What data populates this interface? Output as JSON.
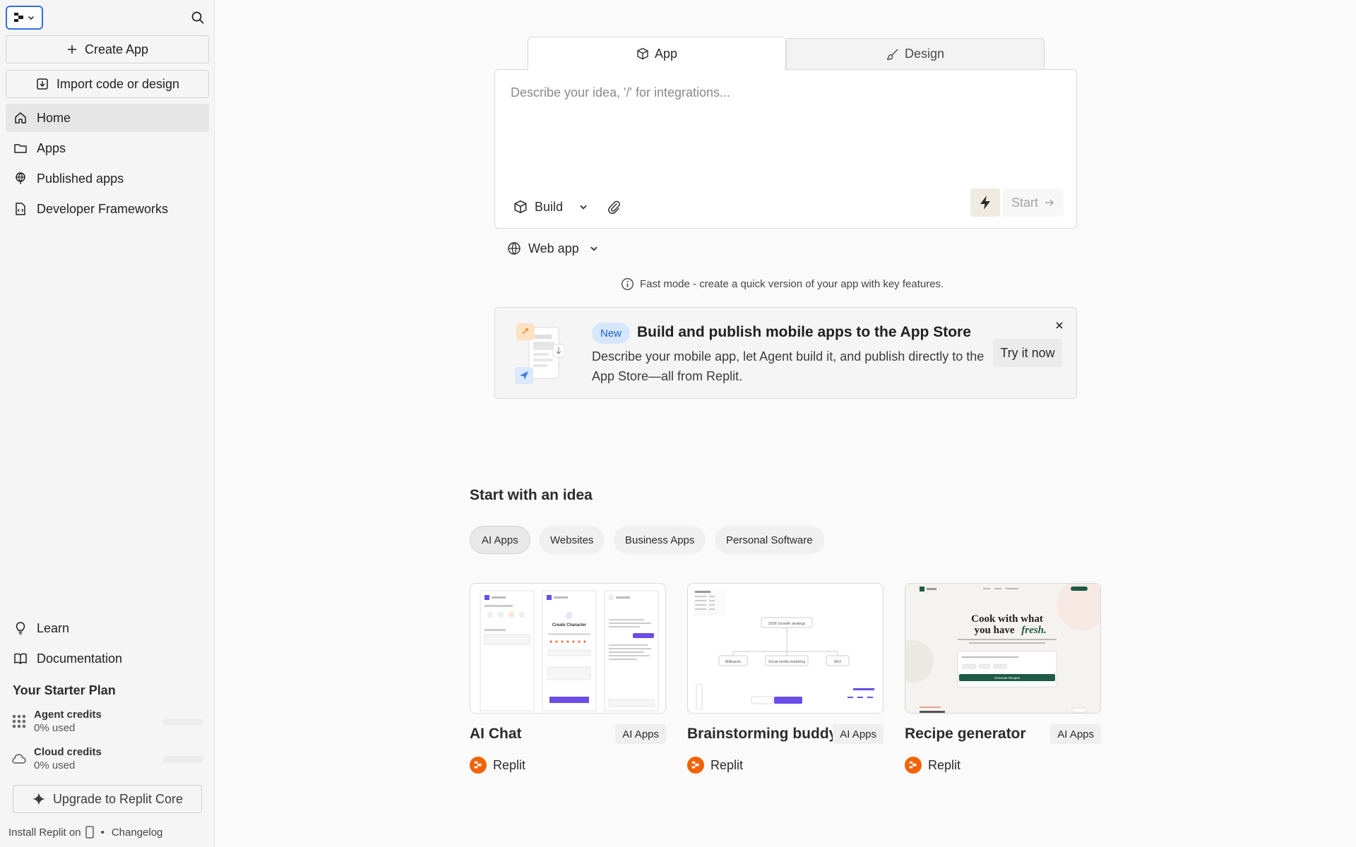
{
  "sidebar": {
    "create_app": "Create App",
    "import_code": "Import code or design",
    "nav": [
      {
        "label": "Home",
        "icon": "home-icon"
      },
      {
        "label": "Apps",
        "icon": "folder-icon"
      },
      {
        "label": "Published apps",
        "icon": "globe-icon"
      },
      {
        "label": "Developer Frameworks",
        "icon": "file-code-icon"
      }
    ],
    "learn": "Learn",
    "documentation": "Documentation",
    "plan_title": "Your Starter Plan",
    "agent_credits": {
      "name": "Agent credits",
      "used": "0% used",
      "progress": 0
    },
    "cloud_credits": {
      "name": "Cloud credits",
      "used": "0% used",
      "progress": 0
    },
    "upgrade": "Upgrade to Replit Core",
    "install": "Install Replit on",
    "separator": "•",
    "changelog": "Changelog"
  },
  "prompt": {
    "tabs": [
      {
        "label": "App",
        "icon": "cube-icon",
        "active": true
      },
      {
        "label": "Design",
        "icon": "brush-icon",
        "active": false
      }
    ],
    "placeholder": "Describe your idea, '/' for integrations...",
    "build_label": "Build",
    "start_label": "Start",
    "web_app_label": "Web app",
    "fast_mode_note": "Fast mode - create a quick version of your app with key features."
  },
  "promo": {
    "badge": "New",
    "title": "Build and publish mobile apps to the App Store",
    "description": "Describe your mobile app, let Agent build it, and publish directly to the App Store—all from Replit.",
    "cta": "Try it now"
  },
  "ideas": {
    "title": "Start with an idea",
    "chips": [
      "AI Apps",
      "Websites",
      "Business Apps",
      "Personal Software"
    ],
    "active_chip": "AI Apps",
    "cards": [
      {
        "title": "AI Chat",
        "tag": "AI Apps",
        "author": "Replit"
      },
      {
        "title": "Brainstorming buddy",
        "tag": "AI Apps",
        "author": "Replit"
      },
      {
        "title": "Recipe generator",
        "tag": "AI Apps",
        "author": "Replit"
      }
    ],
    "thumb_text": {
      "chat_create": "Create Character",
      "brain_center": "2026 Growth strategy",
      "brain_left": "Billboards",
      "brain_mid": "Social media marketing",
      "brain_right": "SEO",
      "recipe_head1": "Cook with what",
      "recipe_head2": "you have",
      "recipe_head_em": "fresh.",
      "recipe_btn": "Generate Recipes"
    }
  },
  "colors": {
    "accent_blue": "#2f6fe4",
    "replit_orange": "#f26207",
    "sidebar_bg": "#f5f5f5",
    "page_bg": "#fafafa",
    "badge_blue": "#d6e6fb"
  }
}
